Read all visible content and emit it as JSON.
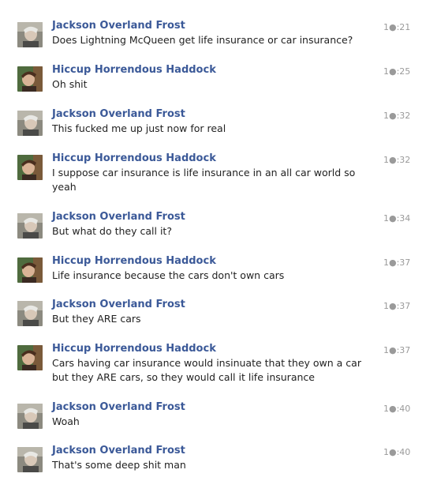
{
  "messages": [
    {
      "author": "Jackson Overland Frost",
      "text": "Does Lightning McQueen get life insurance or car insurance?",
      "time": "1●:21",
      "avatar": "jackson-avatar"
    },
    {
      "author": "Hiccup Horrendous Haddock",
      "text": "Oh shit",
      "time": "1●:25",
      "avatar": "hiccup-avatar"
    },
    {
      "author": "Jackson Overland Frost",
      "text": "This fucked me up just now for real",
      "time": "1●:32",
      "avatar": "jackson-avatar"
    },
    {
      "author": "Hiccup Horrendous Haddock",
      "text": "I suppose car insurance is life insurance in an all car world so yeah",
      "time": "1●:32",
      "avatar": "hiccup-avatar"
    },
    {
      "author": "Jackson Overland Frost",
      "text": "But what do they call it?",
      "time": "1●:34",
      "avatar": "jackson-avatar"
    },
    {
      "author": "Hiccup Horrendous Haddock",
      "text": "Life insurance because the cars don't own cars",
      "time": "1●:37",
      "avatar": "hiccup-avatar"
    },
    {
      "author": "Jackson Overland Frost",
      "text": "But they ARE cars",
      "time": "1●:37",
      "avatar": "jackson-avatar"
    },
    {
      "author": "Hiccup Horrendous Haddock",
      "text": "Cars having car insurance would insinuate that they own a car but they ARE cars, so they would call it life insurance",
      "time": "1●:37",
      "avatar": "hiccup-avatar"
    },
    {
      "author": "Jackson Overland Frost",
      "text": "Woah",
      "time": "1●:40",
      "avatar": "jackson-avatar"
    },
    {
      "author": "Jackson Overland Frost",
      "text": "That's some deep shit man",
      "time": "1●:40",
      "avatar": "jackson-avatar"
    }
  ]
}
